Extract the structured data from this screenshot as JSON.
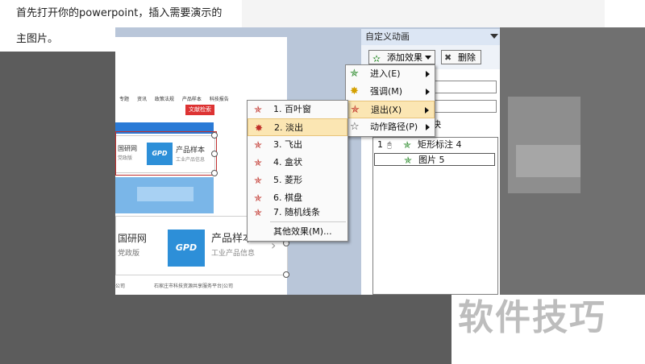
{
  "article": {
    "line1": "首先打开你的powerpoint，插入需要演示的",
    "line2": "主图片。"
  },
  "watermark": "软件技巧",
  "slide": {
    "nav_items": [
      "专题",
      "资讯",
      "政策法规",
      "产品样本",
      "科技报告"
    ],
    "search_button": "文献检索",
    "card_small_left": "国研网",
    "card_small_left_sub": "党政版",
    "card_small_title": "产品样本",
    "card_small_sub": "工业产品信息",
    "logo_text": "GPD",
    "card_big_left": "国研网",
    "card_big_left_sub": "党政版",
    "card_big_title": "产品样本",
    "card_big_sub": "工业产品信息",
    "footer_left": "公司",
    "footer_right": "石家庄市科技资源共享服务平台|公司"
  },
  "task_pane": {
    "title": "自定义动画",
    "add_effect": "添加效果",
    "delete": "删除",
    "speed_label": "快",
    "animations": [
      {
        "num": "1",
        "label": "矩形标注 4"
      },
      {
        "num": "",
        "label": "图片 5"
      }
    ]
  },
  "add_effect_menu": [
    {
      "label": "进入(E)",
      "icon": "entrance-star-icon"
    },
    {
      "label": "强调(M)",
      "icon": "emphasis-star-icon"
    },
    {
      "label": "退出(X)",
      "icon": "exit-star-icon"
    },
    {
      "label": "动作路径(P)",
      "icon": "motion-path-star-icon"
    }
  ],
  "exit_menu": [
    {
      "label": "1. 百叶窗"
    },
    {
      "label": "2. 淡出"
    },
    {
      "label": "3. 飞出"
    },
    {
      "label": "4. 盒状"
    },
    {
      "label": "5. 菱形"
    },
    {
      "label": "6. 棋盘"
    },
    {
      "label": "7. 随机线条"
    },
    {
      "label": "其他效果(M)..."
    }
  ],
  "colors": {
    "menu_highlight": "#fbe6b3",
    "exit_icon": "#c03028",
    "entrance_icon": "#2a8a2a",
    "logo_blue": "#2d8fd8",
    "search_red": "#dd3333"
  }
}
